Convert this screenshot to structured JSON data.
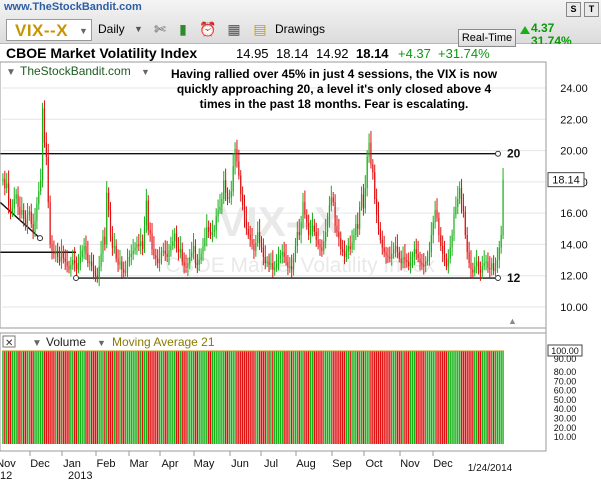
{
  "toolbar": {
    "site": "www.TheStockBandit.com",
    "ticker": "VIX--X",
    "period": "Daily",
    "drawings_label": "Drawings",
    "realtime_label": "Real-Time",
    "last_change": "4.37",
    "last_change_pct": "31.74%",
    "s_button": "S",
    "t_button": "T"
  },
  "header": {
    "title": "CBOE Market Volatility Index",
    "open": "14.95",
    "high": "18.14",
    "low": "14.92",
    "close": "18.14",
    "change": "+4.37",
    "change_pct": "+31.74%"
  },
  "colors": {
    "up": "#16b016",
    "down": "#e01010",
    "gold": "#c89400",
    "grid": "#e6e6e6"
  },
  "chart_data": [
    {
      "type": "candlestick",
      "title": "CBOE Market Volatility Index",
      "source_label": "TheStockBandit.com",
      "watermark_symbol": "VIX--X",
      "watermark_name": "CBOE Market Volatility Index",
      "annotation": "Having rallied over 45% in just 4 sessions, the VIX is now quickly approaching 20, a level it's only closed above 4 times in the past 18 months. Fear is escalating.",
      "ylim": [
        10,
        25
      ],
      "y_ticks": [
        "24.00",
        "22.00",
        "20.00",
        "18.00",
        "16.00",
        "14.00",
        "12.00",
        "10.00"
      ],
      "last_price": "18.14",
      "levels": [
        {
          "label": "20",
          "value": 19.8
        },
        {
          "label": "12",
          "value": 11.85
        }
      ],
      "extra_lines": [
        {
          "value": 13.5
        }
      ],
      "trendline": {
        "from": 16.7,
        "to": 14.4
      },
      "x_ticks": [
        "Nov",
        "Dec",
        "Jan",
        "Feb",
        "Mar",
        "Apr",
        "May",
        "Jun",
        "Jul",
        "Aug",
        "Sep",
        "Oct",
        "Nov",
        "Dec"
      ],
      "x_year_labels": [
        {
          "label": "12",
          "under": "Nov"
        },
        {
          "label": "2013",
          "under": "Jan"
        }
      ],
      "x_end_label": "1/24/2014",
      "closes": [
        18.2,
        17.6,
        17.9,
        16.5,
        16.0,
        16.3,
        16.9,
        17.2,
        16.4,
        15.9,
        16.2,
        15.6,
        15.2,
        15.9,
        16.1,
        15.3,
        14.8,
        15.5,
        16.6,
        17.4,
        18.1,
        22.7,
        20.5,
        19.6,
        16.7,
        14.0,
        13.5,
        13.4,
        13.6,
        13.2,
        12.9,
        13.5,
        13.1,
        12.9,
        12.6,
        12.4,
        12.7,
        13.0,
        12.8,
        12.4,
        12.8,
        13.2,
        13.6,
        13.9,
        13.4,
        12.8,
        12.9,
        12.6,
        12.3,
        12.0,
        11.8,
        12.6,
        13.4,
        14.5,
        14.0,
        17.3,
        16.2,
        14.5,
        13.8,
        13.9,
        13.1,
        12.7,
        12.9,
        12.4,
        12.2,
        12.3,
        12.9,
        13.2,
        13.4,
        13.6,
        13.8,
        14.0,
        13.9,
        14.2,
        13.7,
        15.2,
        16.8,
        14.9,
        14.7,
        13.7,
        13.3,
        13.1,
        12.8,
        13.1,
        13.5,
        13.6,
        13.4,
        13.2,
        13.6,
        13.9,
        14.2,
        14.7,
        13.8,
        13.5,
        13.7,
        12.9,
        12.6,
        12.5,
        12.8,
        13.2,
        13.5,
        13.9,
        12.8,
        12.7,
        13.0,
        13.4,
        13.9,
        14.4,
        15.1,
        14.8,
        14.6,
        14.8,
        14.9,
        15.8,
        16.2,
        16.4,
        16.9,
        18.1,
        17.3,
        16.9,
        17.0,
        17.4,
        19.0,
        20.1,
        19.3,
        18.4,
        17.2,
        16.5,
        15.6,
        15.0,
        14.6,
        14.3,
        14.0,
        13.6,
        14.1,
        14.8,
        14.1,
        13.8,
        13.2,
        12.8,
        12.9,
        12.7,
        12.8,
        12.4,
        12.5,
        12.8,
        13.1,
        13.3,
        13.5,
        13.2,
        12.9,
        12.5,
        12.6,
        12.4,
        13.1,
        13.9,
        14.8,
        14.6,
        15.4,
        16.7,
        15.9,
        15.4,
        14.6,
        14.9,
        15.2,
        14.8,
        14.3,
        14.0,
        13.8,
        13.6,
        14.2,
        14.8,
        15.6,
        16.5,
        17.0,
        16.7,
        15.2,
        14.8,
        14.4,
        13.7,
        13.5,
        13.2,
        13.6,
        13.9,
        13.7,
        14.1,
        14.6,
        15.3,
        15.0,
        16.4,
        17.2,
        16.3,
        17.6,
        19.6,
        20.5,
        19.1,
        18.6,
        16.9,
        15.9,
        15.0,
        14.3,
        13.8,
        13.5,
        13.3,
        13.2,
        13.1,
        13.4,
        13.7,
        13.9,
        13.5,
        13.1,
        12.8,
        13.2,
        13.0,
        12.9,
        12.6,
        12.8,
        13.2,
        13.7,
        13.4,
        13.1,
        12.8,
        12.7,
        12.6,
        12.9,
        13.1,
        13.5,
        14.6,
        15.4,
        16.2,
        15.7,
        14.6,
        13.9,
        13.4,
        13.0,
        12.6,
        13.1,
        13.8,
        14.6,
        15.9,
        16.4,
        16.9,
        17.6,
        16.5,
        16.1,
        14.6,
        13.5,
        12.8,
        12.4,
        12.2,
        12.6,
        12.9,
        12.4,
        12.2,
        12.6,
        12.8,
        12.9,
        12.5,
        12.4,
        12.8,
        12.3,
        12.5,
        13.0,
        13.8,
        14.6,
        18.14
      ],
      "volume_scale": {
        "top": "100.00",
        "mid": "90.00",
        "ticks": [
          "80.00",
          "70.00",
          "60.00",
          "50.00",
          "40.00",
          "30.00",
          "20.00",
          "10.00"
        ]
      }
    }
  ],
  "volume_panel": {
    "label": "Volume",
    "ma_label": "Moving Average 21"
  }
}
